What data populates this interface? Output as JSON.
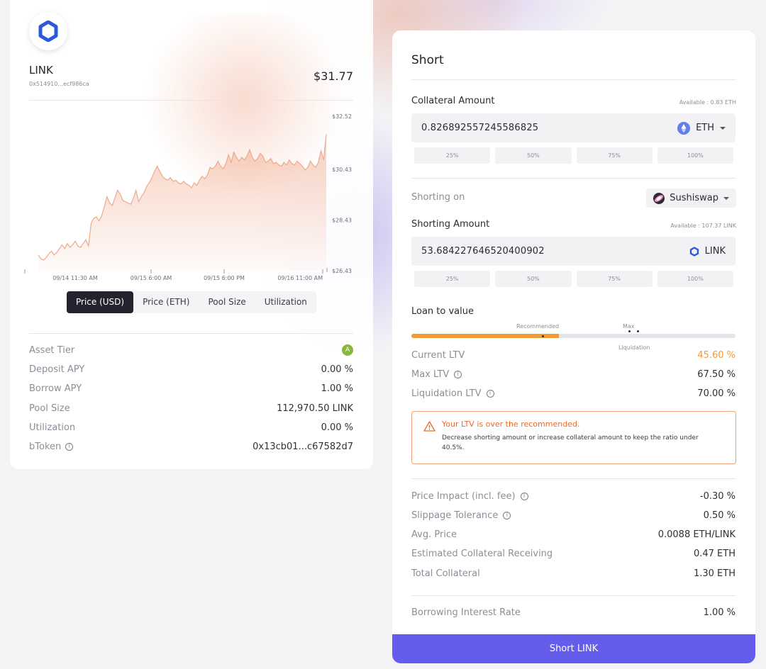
{
  "token": {
    "name": "LINK",
    "address": "0x514910...ecf986ca",
    "price": "$31.77"
  },
  "chart_data": {
    "type": "area",
    "xlabels": [
      "09/14 11:30 AM",
      "09/15 6:00 AM",
      "09/15 6:00 PM",
      "09/16 11:00 AM"
    ],
    "ytick_labels": [
      "$32.52",
      "$30.43",
      "$28.43",
      "$26.43"
    ],
    "ylim": [
      26.43,
      32.52
    ],
    "y": [
      27.05,
      26.9,
      26.85,
      26.95,
      27.1,
      27.2,
      27.05,
      27.15,
      27.3,
      27.45,
      27.3,
      27.5,
      27.35,
      27.45,
      27.6,
      27.4,
      27.35,
      27.5,
      27.65,
      27.4,
      28.3,
      28.5,
      28.55,
      28.4,
      28.6,
      28.95,
      29.35,
      29.1,
      29.0,
      29.3,
      29.6,
      29.45,
      29.2,
      29.15,
      29.1,
      29.05,
      29.3,
      29.6,
      29.15,
      29.35,
      29.5,
      29.75,
      29.9,
      30.1,
      30.35,
      30.55,
      30.35,
      30.15,
      30.05,
      30.0,
      30.1,
      29.95,
      30.0,
      29.9,
      29.85,
      29.95,
      29.85,
      29.8,
      29.7,
      29.9,
      29.8,
      30.0,
      30.15,
      30.05,
      30.2,
      30.5,
      30.45,
      30.55,
      30.75,
      30.55,
      30.45,
      30.65,
      31.0,
      30.7,
      31.1,
      30.9,
      30.75,
      30.9,
      30.8,
      30.95,
      31.2,
      30.9,
      30.75,
      30.85,
      31.05,
      30.95,
      30.7,
      30.75,
      30.85,
      30.65,
      30.7,
      30.6,
      30.55,
      30.7,
      30.6,
      30.8,
      30.65,
      30.6,
      30.75,
      30.65,
      30.55,
      30.4,
      30.5,
      30.75,
      30.6,
      30.5,
      30.7,
      31.15,
      30.8,
      31.8
    ],
    "color": "#f0a88a"
  },
  "chart_tabs": [
    "Price (USD)",
    "Price (ETH)",
    "Pool Size",
    "Utilization"
  ],
  "stats": [
    {
      "label": "Asset Tier",
      "value": "A"
    },
    {
      "label": "Deposit APY",
      "value": "0.00 %"
    },
    {
      "label": "Borrow APY",
      "value": "1.00 %"
    },
    {
      "label": "Pool Size",
      "value": "112,970.50 LINK"
    },
    {
      "label": "Utilization",
      "value": "0.00 %"
    },
    {
      "label": "bToken",
      "value": "0x13cb01...c67582d7"
    }
  ],
  "short": {
    "title": "Short",
    "collateral_label": "Collateral Amount",
    "collateral_available": "Available : 0.83 ETH",
    "collateral_value": "0.826892557245586825",
    "collateral_asset": "ETH",
    "percents": [
      "25%",
      "50%",
      "75%",
      "100%"
    ],
    "shorting_on_label": "Shorting on",
    "dex": "Sushiswap",
    "shorting_amount_label": "Shorting Amount",
    "shorting_available": "Available : 107.37 LINK",
    "shorting_value": "53.684227646520400902",
    "shorting_asset": "LINK",
    "ltv_label": "Loan to value",
    "ltv_fraction": 0.456,
    "recommended_label": "Recommended",
    "max_label": "Max",
    "liquidation_label": "Liquidation",
    "current_ltv_label": "Current LTV",
    "current_ltv": "45.60 %",
    "max_ltv_label": "Max LTV",
    "max_ltv": "67.50 %",
    "liq_ltv_label": "Liquidation LTV",
    "liq_ltv": "70.00 %",
    "warning_title": "Your LTV is over the recommended.",
    "warning_desc": "Decrease shorting amount or increase collateral amount to keep the ratio under 40.5%.",
    "details": [
      {
        "label": "Price Impact (incl. fee)",
        "value": "-0.30 %",
        "info": true
      },
      {
        "label": "Slippage Tolerance",
        "value": "0.50 %",
        "info": true
      },
      {
        "label": "Avg. Price",
        "value": "0.0088 ETH/LINK",
        "info": false
      },
      {
        "label": "Estimated Collateral Receiving",
        "value": "0.47 ETH",
        "info": false
      },
      {
        "label": "Total Collateral",
        "value": "1.30 ETH",
        "info": false
      }
    ],
    "interest_label": "Borrowing Interest Rate",
    "interest_value": "1.00 %",
    "submit_label": "Short LINK"
  },
  "colors": {
    "accent": "#645dec",
    "warning": "#ee6a2b",
    "ltv_fill": "#f29b35",
    "tier_badge": "#8ab63f"
  }
}
